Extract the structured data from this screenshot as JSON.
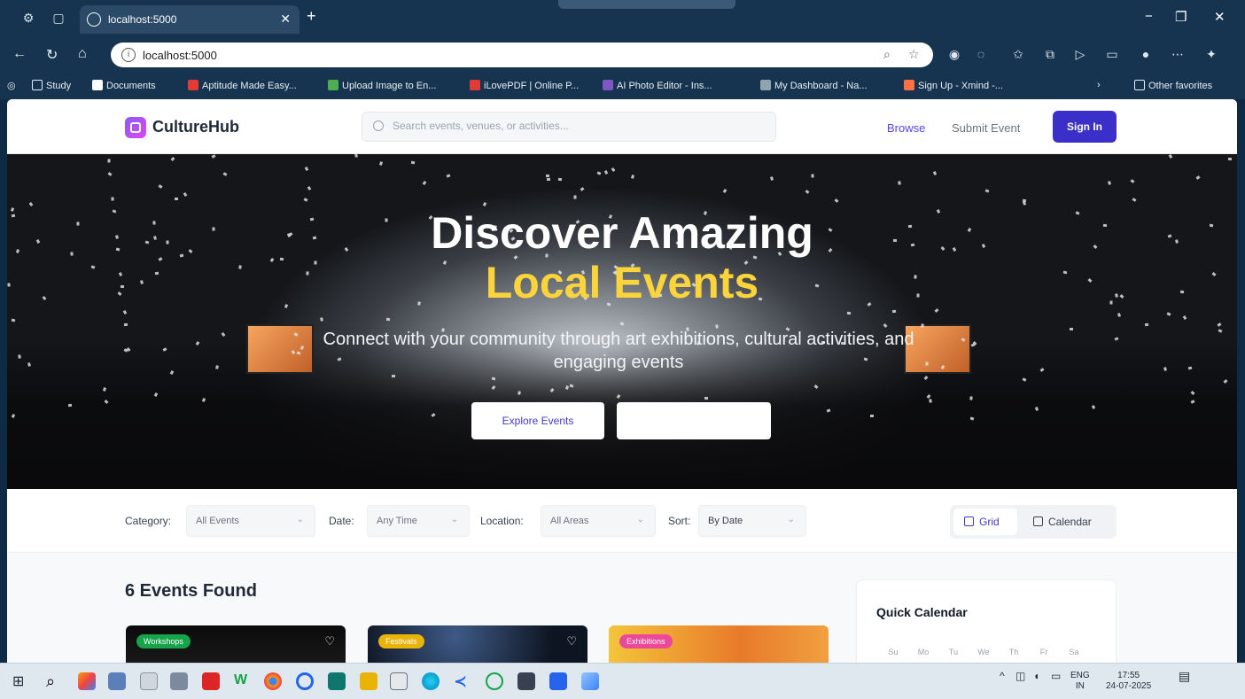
{
  "browser": {
    "tab_title": "localhost:5000",
    "url": "localhost:5000",
    "bookmarks": [
      {
        "label": "Study",
        "color": "#f3d27a"
      },
      {
        "label": "Documents",
        "color": "#ffffff"
      },
      {
        "label": "Aptitude Made Easy...",
        "color": "#e53935"
      },
      {
        "label": "Upload Image to En...",
        "color": "#4caf50"
      },
      {
        "label": "iLovePDF | Online P...",
        "color": "#e53935"
      },
      {
        "label": "AI Photo Editor - Ins...",
        "color": "#7e57c2"
      },
      {
        "label": "My Dashboard - Na...",
        "color": "#90a4ae"
      },
      {
        "label": "Sign Up - Xmind -...",
        "color": "#ff7043"
      }
    ],
    "other_favorites": "Other favorites"
  },
  "header": {
    "brand": "CultureHub",
    "search_placeholder": "Search events, venues, or activities...",
    "browse": "Browse",
    "submit_event": "Submit Event",
    "sign_in": "Sign In",
    "accent": "#3b2fc9"
  },
  "hero": {
    "title_line1": "Discover Amazing",
    "title_line2": "Local Events",
    "subtitle": "Connect with your community through art exhibitions, cultural activities, and engaging events",
    "primary_button": "Explore Events",
    "secondary_button": "",
    "highlight_color": "#fbd43c"
  },
  "filters": {
    "category_label": "Category:",
    "category_value": "All Events",
    "date_label": "Date:",
    "date_value": "Any Time",
    "location_label": "Location:",
    "location_value": "All Areas",
    "sort_label": "Sort:",
    "sort_value": "By Date",
    "view_grid": "Grid",
    "view_calendar": "Calendar"
  },
  "results": {
    "count_text": "6 Events Found",
    "cards": [
      {
        "badge": "Workshops",
        "badge_color": "#16a34a"
      },
      {
        "badge": "Festivals",
        "badge_color": "#eab308"
      },
      {
        "badge": "Exhibitions",
        "badge_color": "#ec4899"
      }
    ]
  },
  "quick_calendar": {
    "title": "Quick Calendar",
    "days": [
      "Su",
      "Mo",
      "Tu",
      "We",
      "Th",
      "Fr",
      "Sa"
    ]
  },
  "taskbar": {
    "lang_line1": "ENG",
    "lang_line2": "IN",
    "time": "17:55",
    "date": "24-07-2025"
  }
}
